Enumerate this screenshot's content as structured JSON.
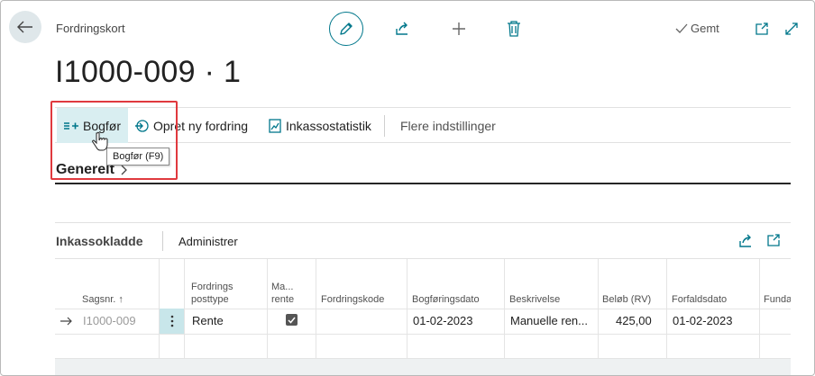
{
  "header": {
    "caption": "Fordringskort",
    "title": "I1000-009 · 1",
    "saved_label": "Gemt"
  },
  "actions": {
    "post": "Bogfør",
    "new_claim": "Opret ny fordring",
    "statistics": "Inkassostatistik",
    "more": "Flere indstillinger",
    "tooltip": "Bogfør (F9)"
  },
  "general": {
    "title": "Generelt"
  },
  "journal": {
    "title": "Inkassokladde",
    "manage": "Administrer",
    "columns": {
      "case_no": "Sagsnr. ↑",
      "claim_type_1": "Fordrings",
      "claim_type_2": "posttype",
      "manual_1": "Ma...",
      "manual_2": "rente",
      "claim_code": "Fordringskode",
      "posting_date": "Bogføringsdato",
      "description": "Beskrivelse",
      "amount": "Beløb (RV)",
      "due_date": "Forfaldsdato",
      "next": "Funda"
    },
    "rows": [
      {
        "case_no": "I1000-009",
        "claim_type": "Rente",
        "manual_interest": true,
        "claim_code": "",
        "posting_date": "01-02-2023",
        "description": "Manuelle ren...",
        "amount": "425,00",
        "due_date": "01-02-2023"
      }
    ]
  },
  "colors": {
    "accent": "#00778b",
    "highlight": "#e0393e",
    "hover": "#d9eef1"
  }
}
